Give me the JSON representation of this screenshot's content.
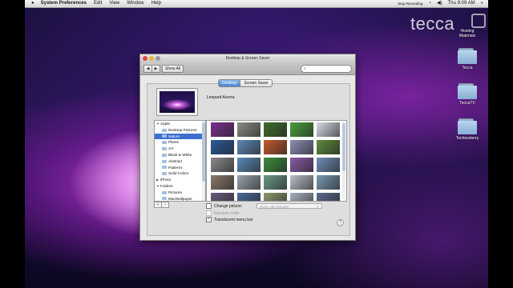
{
  "menubar": {
    "apple": "",
    "app_name": "System Preferences",
    "items": [
      "Edit",
      "View",
      "Window",
      "Help"
    ],
    "recording": "Stop Recording",
    "clock": "Thu 9:09 AM",
    "colors": {
      "bar": "#e4e4e4"
    }
  },
  "watermark": "tecca",
  "desktop_icons": [
    {
      "label_line1": "Hosting",
      "label_line2": "Materials",
      "icon": "folder-icon"
    },
    {
      "label_line1": "Tecca",
      "label_line2": "",
      "icon": "folder-icon"
    },
    {
      "label_line1": "TeccaTV",
      "label_line2": "",
      "icon": "folder-icon"
    },
    {
      "label_line1": "Technoslerry",
      "label_line2": "",
      "icon": "folder-icon"
    }
  ],
  "window": {
    "title": "Desktop & Screen Saver",
    "back": "◀",
    "forward": "▶",
    "show_all": "Show All",
    "search_placeholder": "",
    "tabs": [
      "Desktop",
      "Screen Saver"
    ],
    "active_tab": "Desktop",
    "current_picture": "Leopard Aurora",
    "sources": [
      {
        "label": "Apple",
        "type": "group",
        "expanded": true
      },
      {
        "label": "Desktop Pictures",
        "type": "folder"
      },
      {
        "label": "Nature",
        "type": "folder",
        "selected": true
      },
      {
        "label": "Plants",
        "type": "folder"
      },
      {
        "label": "Art",
        "type": "folder"
      },
      {
        "label": "Black & White",
        "type": "folder"
      },
      {
        "label": "Abstract",
        "type": "folder"
      },
      {
        "label": "Patterns",
        "type": "folder"
      },
      {
        "label": "Solid Colors",
        "type": "folder"
      },
      {
        "label": "iPhoto",
        "type": "group",
        "expanded": false
      },
      {
        "label": "Folders",
        "type": "group",
        "expanded": true
      },
      {
        "label": "Pictures",
        "type": "folder"
      },
      {
        "label": "MacWallpaper",
        "type": "folder"
      }
    ],
    "add": "+",
    "remove": "−",
    "change_picture_label": "Change picture:",
    "change_interval": "Every 30 minutes",
    "random_order_label": "Random order",
    "translucent_label": "Translucent menu bar",
    "translucent_checked": true,
    "check_mark": "✓",
    "help": "?"
  },
  "thumbnails": [
    "#7a2f8e",
    "#8a8f86",
    "#3f6e2a",
    "#4aa03a",
    "#d6dde6",
    "#2a5a9a",
    "#5f88b8",
    "#c55a2e",
    "#8c8fb6",
    "#5e8a3c",
    "#8a8a8a",
    "#5a8ab6",
    "#3c8c3a",
    "#8a5aa6",
    "#6c8eb8",
    "#8a7a6a",
    "#9aa6b0",
    "#6a9a8a",
    "#b8c0c8",
    "#7a98b0",
    "#6a5a7a",
    "#4a6a9a",
    "#8a9a6a",
    "#a8b0c0",
    "#5a6a8a"
  ]
}
